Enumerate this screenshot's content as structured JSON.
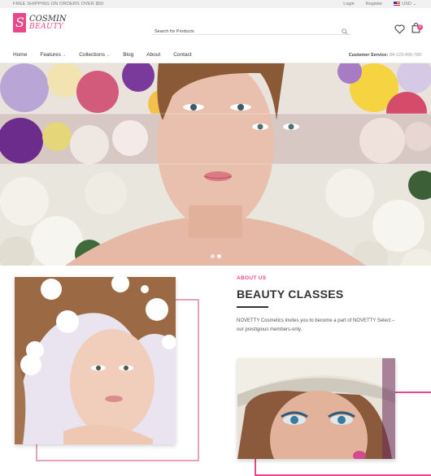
{
  "topbar": {
    "shipping": "FREE SHIPPING ON ORDERS OVER $50",
    "login": "Login",
    "register": "Register",
    "currency": "USD"
  },
  "logo": {
    "line1": "COSMIN",
    "line2": "BEAUTY"
  },
  "search": {
    "placeholder": "Search for Products"
  },
  "cart": {
    "count": "0"
  },
  "nav": {
    "items": [
      {
        "label": "Home"
      },
      {
        "label": "Features"
      },
      {
        "label": "Collections"
      },
      {
        "label": "Blog"
      },
      {
        "label": "About"
      },
      {
        "label": "Contact"
      }
    ],
    "service_label": "Customer Service:",
    "service_phone": "84-123-456-789"
  },
  "about": {
    "label": "ABOUT US",
    "title": "BEAUTY CLASSES",
    "text": "NOVETTY Cosmetics invites you to become a part of NOVETTY Select – our prestigious members-only."
  },
  "colors": {
    "accent": "#e8488a",
    "frame": "#e3a4b7"
  }
}
